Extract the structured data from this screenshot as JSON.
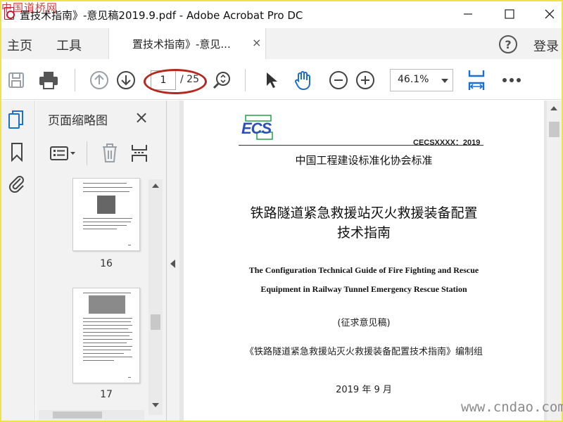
{
  "watermark_top": "中国道桥网",
  "watermark_bottom": "www.cndao.com",
  "window": {
    "title": "置技术指南》-意见稿2019.9.pdf - Adobe Acrobat Pro DC"
  },
  "menubar": {
    "home": "主页",
    "tools": "工具",
    "tab_label": "置技术指南》-意见...",
    "tab_close": "×",
    "help": "?",
    "login": "登录"
  },
  "toolbar": {
    "current_page": "1",
    "total_pages": "/ 25",
    "zoom": "46.1%"
  },
  "thumbnails": {
    "title": "页面缩略图",
    "close": "×",
    "pages": [
      {
        "label": "16"
      },
      {
        "label": "17"
      }
    ]
  },
  "document": {
    "logo": "ECS",
    "code": "CECSXXXX：2019",
    "association": "中国工程建设标准化协会标准",
    "title_cn_line1": "铁路隧道紧急救援站灭火救援装备配置",
    "title_cn_line2": "技术指南",
    "title_en_line1": "The Configuration Technical Guide of Fire Fighting and Rescue",
    "title_en_line2": "Equipment in Railway Tunnel Emergency Rescue Station",
    "draft": "(征求意见稿)",
    "compiler": "《铁路隧道紧急救援站灭火救援装备配置技术指南》编制组",
    "date": "2019 年 9 月"
  },
  "colors": {
    "accent": "#1a6fd0",
    "annotation": "#b5271f",
    "border": "#f0e24a"
  }
}
